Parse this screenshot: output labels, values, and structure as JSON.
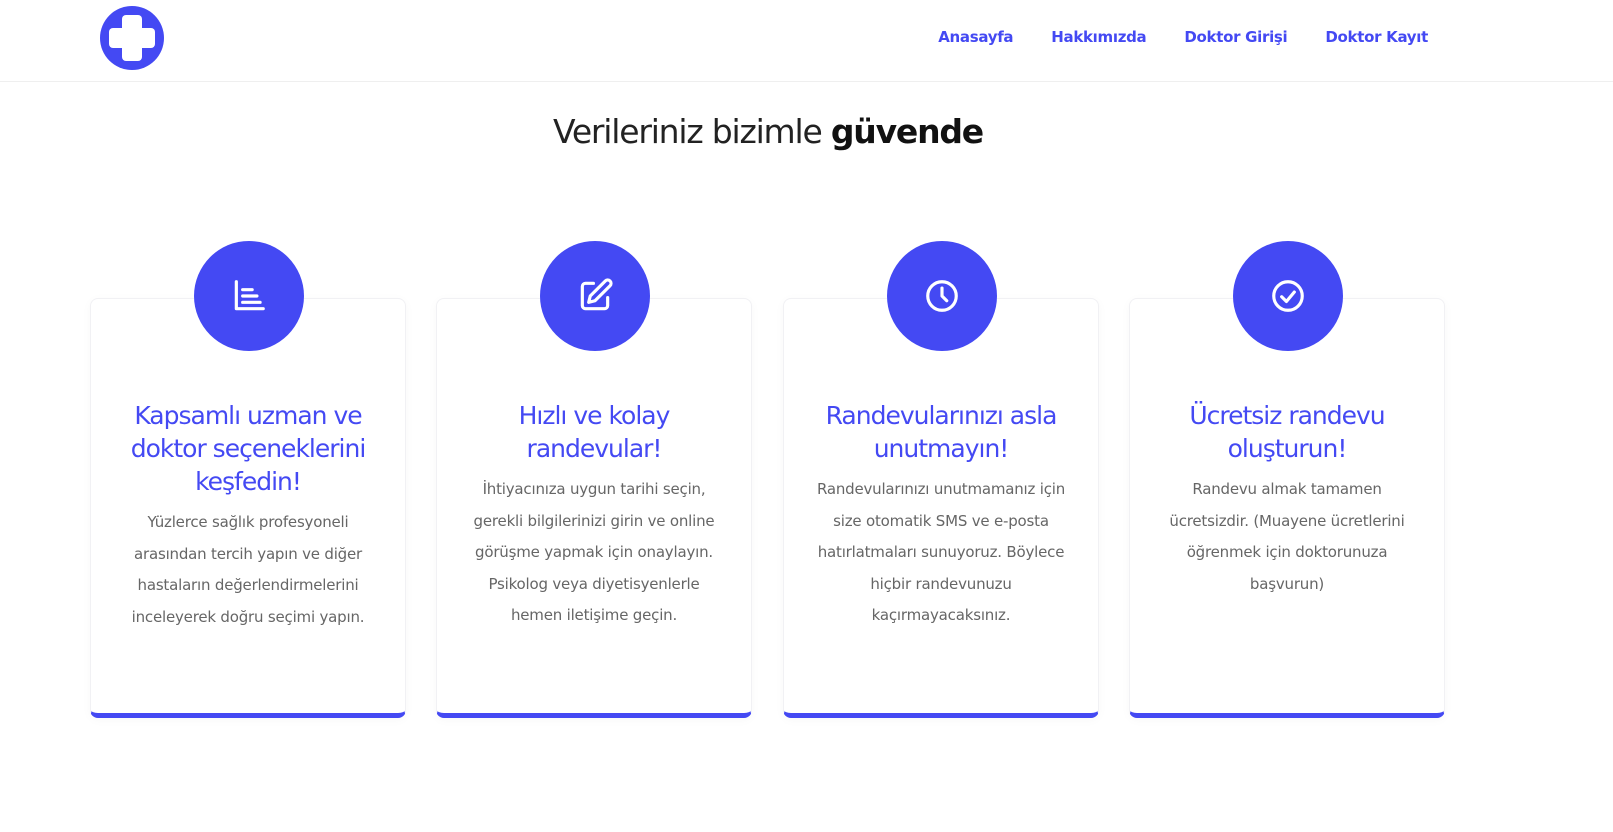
{
  "header": {
    "logo_icon": "medical-cross-icon",
    "nav": [
      {
        "label": "Anasayfa"
      },
      {
        "label": "Hakkımızda"
      },
      {
        "label": "Doktor Girişi"
      },
      {
        "label": "Doktor Kayıt"
      }
    ]
  },
  "section": {
    "title_normal": "Verileriniz bizimle",
    "title_bold": "güvende"
  },
  "cards": [
    {
      "icon": "chart-icon",
      "title": "Kapsamlı uzman ve doktor seçeneklerini keşfedin!",
      "text": "Yüzlerce sağlık profesyoneli arasından tercih yapın ve diğer hastaların değerlendirmelerini inceleyerek doğru seçimi yapın."
    },
    {
      "icon": "edit-icon",
      "title": "Hızlı ve kolay randevular!",
      "text": "İhtiyacınıza uygun tarihi seçin, gerekli bilgilerinizi girin ve online görüşme yapmak için onaylayın. Psikolog veya diyetisyenlerle hemen iletişime geçin."
    },
    {
      "icon": "clock-icon",
      "title": "Randevularınızı asla unutmayın!",
      "text": "Randevularınızı unutmamanız için size otomatik SMS ve e-posta hatırlatmaları sunuyoruz. Böylece hiçbir randevunuzu kaçırmayacaksınız."
    },
    {
      "icon": "check-circle-icon",
      "title": "Ücretsiz randevu oluşturun!",
      "text": "Randevu almak tamamen ücretsizdir. (Muayene ücretlerini öğrenmek için doktorunuza başvurun)"
    }
  ],
  "colors": {
    "accent": "#4449f3",
    "heading": "#222222",
    "body_text": "#666666"
  }
}
